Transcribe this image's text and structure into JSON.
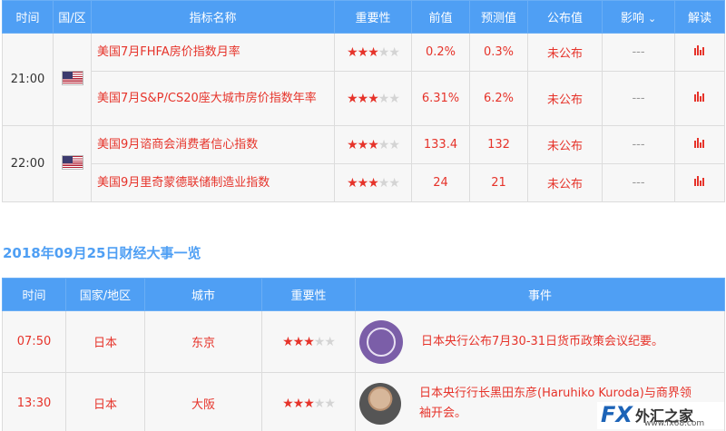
{
  "table1": {
    "headers": [
      "时间",
      "国/区",
      "指标名称",
      "重要性",
      "前值",
      "预测值",
      "公布值",
      "影响",
      "解读"
    ],
    "impact_chevron": "chevron-down-icon",
    "groups": [
      {
        "time": "21:00",
        "flag": "us-flag-icon",
        "rows": [
          {
            "name": "美国7月FHFA房价指数月率",
            "stars": 3,
            "prev": "0.2%",
            "forecast": "0.3%",
            "actual": "未公布",
            "impact": "---"
          },
          {
            "name": "美国7月S&P/CS20座大城市房价指数年率",
            "stars": 3,
            "prev": "6.31%",
            "forecast": "6.2%",
            "actual": "未公布",
            "impact": "---"
          }
        ]
      },
      {
        "time": "22:00",
        "flag": "us-flag-icon",
        "rows": [
          {
            "name": "美国9月谘商会消费者信心指数",
            "stars": 3,
            "prev": "133.4",
            "forecast": "132",
            "actual": "未公布",
            "impact": "---"
          },
          {
            "name": "美国9月里奇蒙德联储制造业指数",
            "stars": 3,
            "prev": "24",
            "forecast": "21",
            "actual": "未公布",
            "impact": "---"
          }
        ]
      }
    ]
  },
  "section_title": "2018年09月25日财经大事一览",
  "table2": {
    "headers": [
      "时间",
      "国家/地区",
      "城市",
      "重要性",
      "事件"
    ],
    "rows": [
      {
        "time": "07:50",
        "country": "日本",
        "city": "东京",
        "stars": 3,
        "image": "boj-seal-icon",
        "event": "日本央行公布7月30-31日货币政策会议纪要。"
      },
      {
        "time": "13:30",
        "country": "日本",
        "city": "大阪",
        "stars": 3,
        "image": "kuroda-portrait",
        "event": "日本央行行长黑田东彦(Haruhiko Kuroda)与商界领袖开会。"
      }
    ]
  },
  "watermark": {
    "brand": "FX",
    "cn": "外汇之家",
    "url": "www.fx68.com"
  },
  "colors": {
    "header_bg": "#4f9ff4",
    "accent_red": "#e6332a",
    "star_off": "#d4d4d4"
  }
}
